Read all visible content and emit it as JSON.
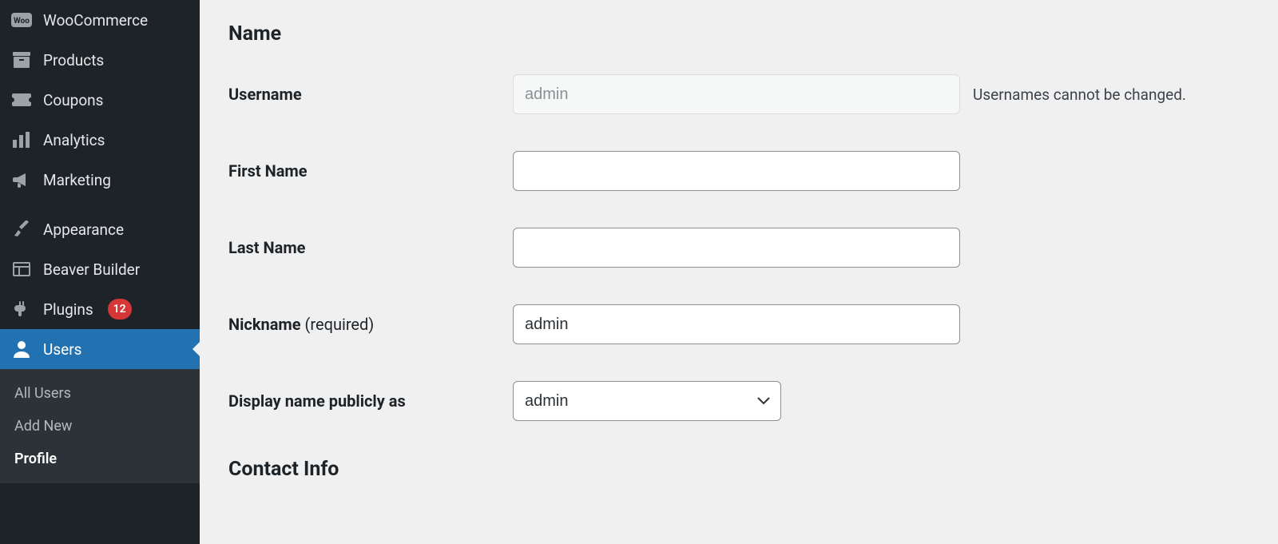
{
  "sidebar": {
    "items": [
      {
        "label": "WooCommerce"
      },
      {
        "label": "Products"
      },
      {
        "label": "Coupons"
      },
      {
        "label": "Analytics"
      },
      {
        "label": "Marketing"
      },
      {
        "label": "Appearance"
      },
      {
        "label": "Beaver Builder"
      },
      {
        "label": "Plugins",
        "badge": "12"
      },
      {
        "label": "Users"
      }
    ],
    "submenu": [
      {
        "label": "All Users"
      },
      {
        "label": "Add New"
      },
      {
        "label": "Profile"
      }
    ]
  },
  "main": {
    "section_name": "Name",
    "username_label": "Username",
    "username_value": "admin",
    "username_help": "Usernames cannot be changed.",
    "first_name_label": "First Name",
    "first_name_value": "",
    "last_name_label": "Last Name",
    "last_name_value": "",
    "nickname_label": "Nickname",
    "nickname_req": "(required)",
    "nickname_value": "admin",
    "display_label": "Display name publicly as",
    "display_value": "admin",
    "section_contact": "Contact Info"
  }
}
